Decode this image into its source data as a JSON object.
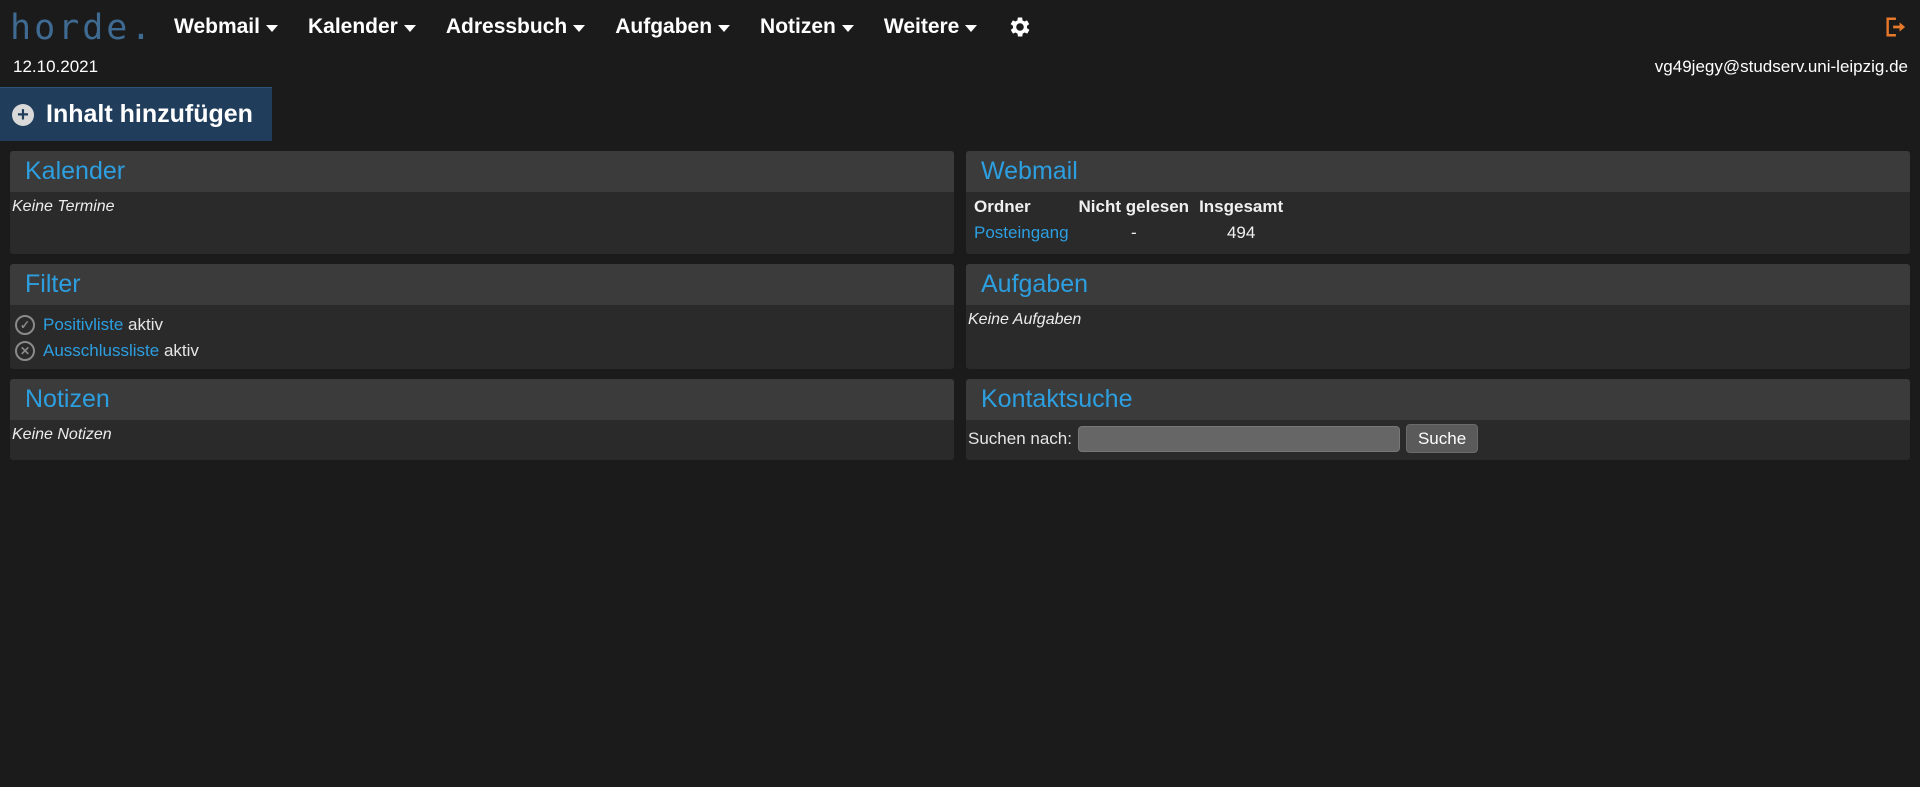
{
  "app": {
    "logo_text": "horde"
  },
  "nav": {
    "items": [
      {
        "label": "Webmail"
      },
      {
        "label": "Kalender"
      },
      {
        "label": "Adressbuch"
      },
      {
        "label": "Aufgaben"
      },
      {
        "label": "Notizen"
      },
      {
        "label": "Weitere"
      }
    ],
    "settings_icon": "gear-icon",
    "logout_icon": "logout-icon"
  },
  "header": {
    "date": "12.10.2021",
    "user": "vg49jegy@studserv.uni-leipzig.de"
  },
  "add_content": {
    "label": "Inhalt hinzufügen",
    "icon": "plus-circle-icon"
  },
  "portlets": {
    "kalender": {
      "title": "Kalender",
      "empty": "Keine Termine"
    },
    "webmail": {
      "title": "Webmail",
      "columns": [
        "Ordner",
        "Nicht gelesen",
        "Insgesamt"
      ],
      "rows": [
        {
          "folder": "Posteingang",
          "unread": "-",
          "total": "494"
        }
      ]
    },
    "filter": {
      "title": "Filter",
      "items": [
        {
          "link": "Positivliste",
          "status": "aktiv",
          "icon": "check-circle-icon"
        },
        {
          "link": "Ausschlussliste",
          "status": "aktiv",
          "icon": "x-circle-icon"
        }
      ]
    },
    "aufgaben": {
      "title": "Aufgaben",
      "empty": "Keine Aufgaben"
    },
    "notizen": {
      "title": "Notizen",
      "empty": "Keine Notizen"
    },
    "kontaktsuche": {
      "title": "Kontaktsuche",
      "search_label": "Suchen nach:",
      "search_value": "",
      "button_label": "Suche"
    }
  },
  "colors": {
    "background": "#1b1b1b",
    "portlet_header": "#3b3b3b",
    "portlet_body": "#2a2a2a",
    "accent_blue": "#2d9fe0",
    "add_button": "#213d5c",
    "logout_orange": "#e8792b"
  }
}
